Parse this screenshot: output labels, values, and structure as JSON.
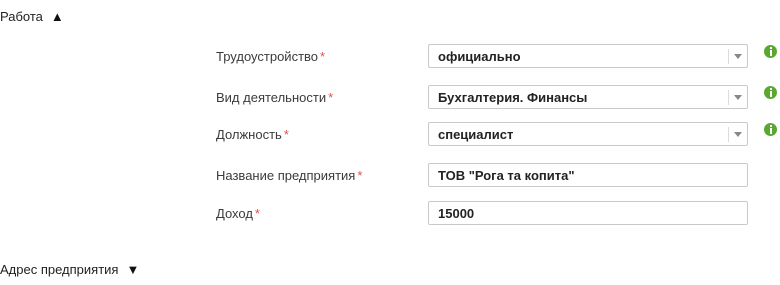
{
  "sections": {
    "work": {
      "title": "Работа",
      "arrow": "▲"
    },
    "company_address": {
      "title": "Адрес предприятия",
      "arrow": "▼"
    }
  },
  "fields": {
    "employment": {
      "label": "Трудоустройство",
      "value": "официально",
      "required": "*"
    },
    "activity": {
      "label": "Вид деятельности",
      "value": "Бухгалтерия. Финансы",
      "required": "*"
    },
    "position": {
      "label": "Должность",
      "value": "специалист",
      "required": "*"
    },
    "company_name": {
      "label": "Название предприятия",
      "value": "ТОВ \"Рога та копита\"",
      "required": "*"
    },
    "income": {
      "label": "Доход",
      "value": "15000",
      "required": "*"
    }
  },
  "icons": {
    "info": "info-icon",
    "caret": "chevron-down-icon"
  },
  "colors": {
    "required": "#d9534f",
    "info": "#5aa832"
  }
}
